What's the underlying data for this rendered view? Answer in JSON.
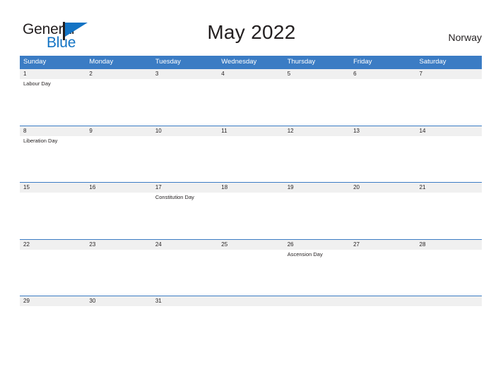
{
  "brand": {
    "name_part1": "General",
    "name_part2": "Blue",
    "logo_icon": "flag-triangle-icon",
    "accent_color": "#1273c4"
  },
  "header": {
    "title": "May 2022",
    "country": "Norway"
  },
  "colors": {
    "header_blue": "#3b7cc4",
    "date_band_gray": "#f0f0f0",
    "text_dark": "#231f20",
    "logo_blue": "#1273c4"
  },
  "calendar": {
    "month": "May",
    "year": "2022",
    "day_headers": [
      "Sunday",
      "Monday",
      "Tuesday",
      "Wednesday",
      "Thursday",
      "Friday",
      "Saturday"
    ],
    "weeks": [
      {
        "days": [
          {
            "num": "1",
            "event": "Labour Day"
          },
          {
            "num": "2",
            "event": ""
          },
          {
            "num": "3",
            "event": ""
          },
          {
            "num": "4",
            "event": ""
          },
          {
            "num": "5",
            "event": ""
          },
          {
            "num": "6",
            "event": ""
          },
          {
            "num": "7",
            "event": ""
          }
        ]
      },
      {
        "days": [
          {
            "num": "8",
            "event": "Liberation Day"
          },
          {
            "num": "9",
            "event": ""
          },
          {
            "num": "10",
            "event": ""
          },
          {
            "num": "11",
            "event": ""
          },
          {
            "num": "12",
            "event": ""
          },
          {
            "num": "13",
            "event": ""
          },
          {
            "num": "14",
            "event": ""
          }
        ]
      },
      {
        "days": [
          {
            "num": "15",
            "event": ""
          },
          {
            "num": "16",
            "event": ""
          },
          {
            "num": "17",
            "event": "Constitution Day"
          },
          {
            "num": "18",
            "event": ""
          },
          {
            "num": "19",
            "event": ""
          },
          {
            "num": "20",
            "event": ""
          },
          {
            "num": "21",
            "event": ""
          }
        ]
      },
      {
        "days": [
          {
            "num": "22",
            "event": ""
          },
          {
            "num": "23",
            "event": ""
          },
          {
            "num": "24",
            "event": ""
          },
          {
            "num": "25",
            "event": ""
          },
          {
            "num": "26",
            "event": "Ascension Day"
          },
          {
            "num": "27",
            "event": ""
          },
          {
            "num": "28",
            "event": ""
          }
        ]
      },
      {
        "days": [
          {
            "num": "29",
            "event": ""
          },
          {
            "num": "30",
            "event": ""
          },
          {
            "num": "31",
            "event": ""
          },
          {
            "num": "",
            "event": ""
          },
          {
            "num": "",
            "event": ""
          },
          {
            "num": "",
            "event": ""
          },
          {
            "num": "",
            "event": ""
          }
        ]
      }
    ]
  }
}
